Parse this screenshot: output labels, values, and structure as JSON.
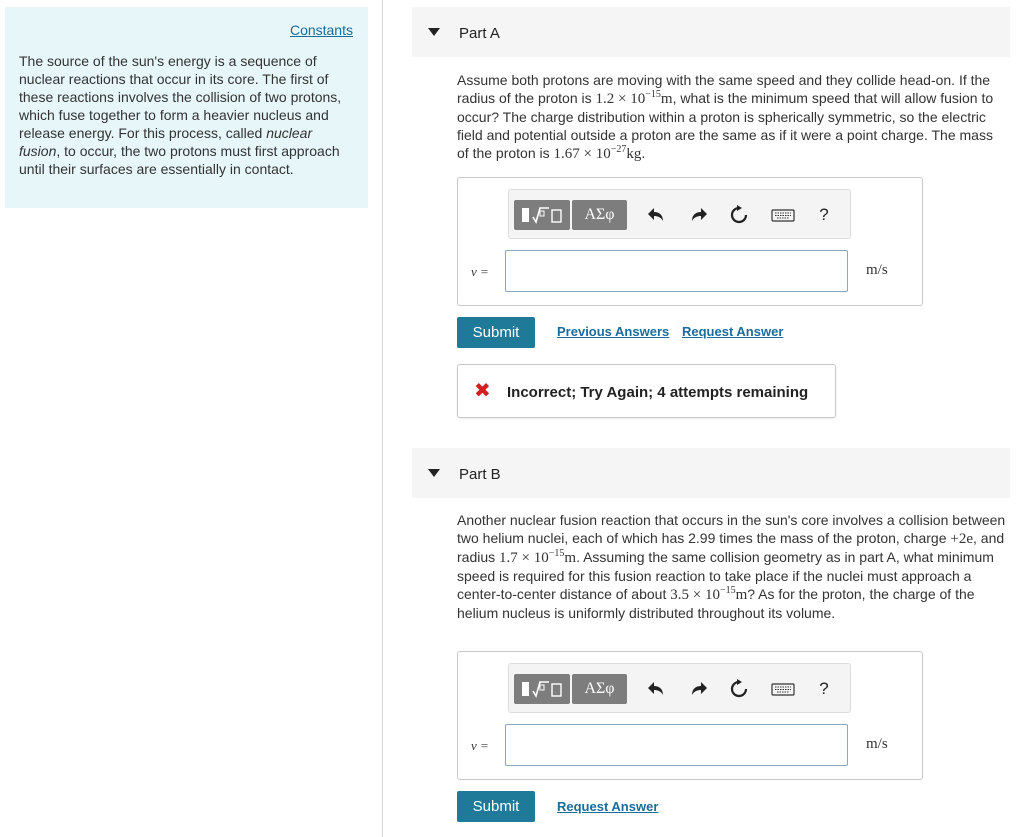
{
  "sidebar": {
    "constants_link": "Constants",
    "intro_prefix": "The source of the sun's energy is a sequence of nuclear reactions that occur in its core. The first of these reactions involves the collision of two protons, which fuse together to form a heavier nucleus and release energy. For this process, called ",
    "intro_emph": "nuclear fusion",
    "intro_suffix": ", to occur, the two protons must first approach until their surfaces are essentially in contact."
  },
  "partA": {
    "title": "Part A",
    "q_1": "Assume both protons are moving with the same speed and they collide head-on. If the radius of the proton is ",
    "q_radius_base": "1.2 × 10",
    "q_radius_exp": "−15",
    "q_radius_unit": "m",
    "q_2": ", what is the minimum speed that will allow fusion to occur? The charge distribution within a proton is spherically symmetric, so the electric field and potential outside a proton are the same as if it were a point charge. The mass of the proton is ",
    "q_mass_base": "1.67 × 10",
    "q_mass_exp": "−27",
    "q_mass_unit": "kg",
    "q_3": ".",
    "var_label": "v =",
    "input_value": "",
    "unit": "m/s",
    "submit_label": "Submit",
    "previous_answers_label": "Previous Answers",
    "request_answer_label": "Request Answer",
    "feedback_icon": "✖",
    "feedback_text": "Incorrect; Try Again; 4 attempts remaining"
  },
  "partB": {
    "title": "Part B",
    "q_1": "Another nuclear fusion reaction that occurs in the sun's core involves a collision between two helium nuclei, each of which has 2.99 times the mass of the proton, charge ",
    "q_charge": "+2e",
    "q_2": ", and radius ",
    "q_radius_base": "1.7 × 10",
    "q_radius_exp": "−15",
    "q_radius_unit": "m",
    "q_3": ". Assuming the same collision geometry as in part A, what minimum speed is required for this fusion reaction to take place if the nuclei must approach a center-to-center distance of about ",
    "q_dist_base": "3.5 × 10",
    "q_dist_exp": "−15",
    "q_dist_unit": "m",
    "q_4": "? As for the proton, the charge of the helium nucleus is uniformly distributed throughout its volume.",
    "var_label": "v =",
    "input_value": "",
    "unit": "m/s",
    "submit_label": "Submit",
    "request_answer_label": "Request Answer"
  },
  "toolbar": {
    "greek_label": "ΑΣφ",
    "help_label": "?"
  },
  "colors": {
    "sidebar_bg": "#e6f6f9",
    "link": "#1a6c9c",
    "submit_bg": "#1f7a99",
    "incorrect_x": "#d21f1f"
  }
}
